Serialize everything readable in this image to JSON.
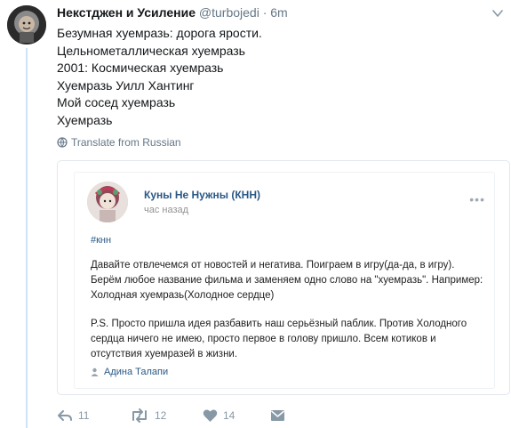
{
  "tweet": {
    "display_name": "Некстджен и Усиление",
    "handle": "@turbojedi",
    "separator": "·",
    "time": "6m",
    "lines": [
      "Безумная хуемразь: дорога ярости.",
      "Цельнометаллическая хуемразь",
      "2001: Космическая хуемразь",
      "Хуемразь Уилл Хантинг",
      "Мой сосед хуемразь",
      "Хуемразь"
    ],
    "translate_label": "Translate from Russian"
  },
  "card": {
    "name": "Куны Не Нужны (КНН)",
    "time": "час назад",
    "more": "•••",
    "hashtag": "#кнн",
    "paragraph1": [
      "Давайте отвлечемся от новостей и негатива. Поиграем в игру(да-да, в игру).",
      "Берём любое название фильма и заменяем одно слово на \"хуемразь\". Например:",
      "Холодная хуемразь(Холодное сердце)"
    ],
    "paragraph2": [
      "P.S. Просто пришла идея разбавить наш серьёзный паблик. Против Холодного",
      "сердца ничего не имею, просто первое в голову пришло. Всем котиков и",
      "отсутствия хуемразей в жизни."
    ],
    "author": "Адина Талапи"
  },
  "actions": {
    "reply_count": "11",
    "retweet_count": "12",
    "like_count": "14"
  },
  "colors": {
    "text": "#14171a",
    "muted": "#657786",
    "action": "#8899a6",
    "vk_link": "#2a5885",
    "thread": "#cfe3f2"
  }
}
